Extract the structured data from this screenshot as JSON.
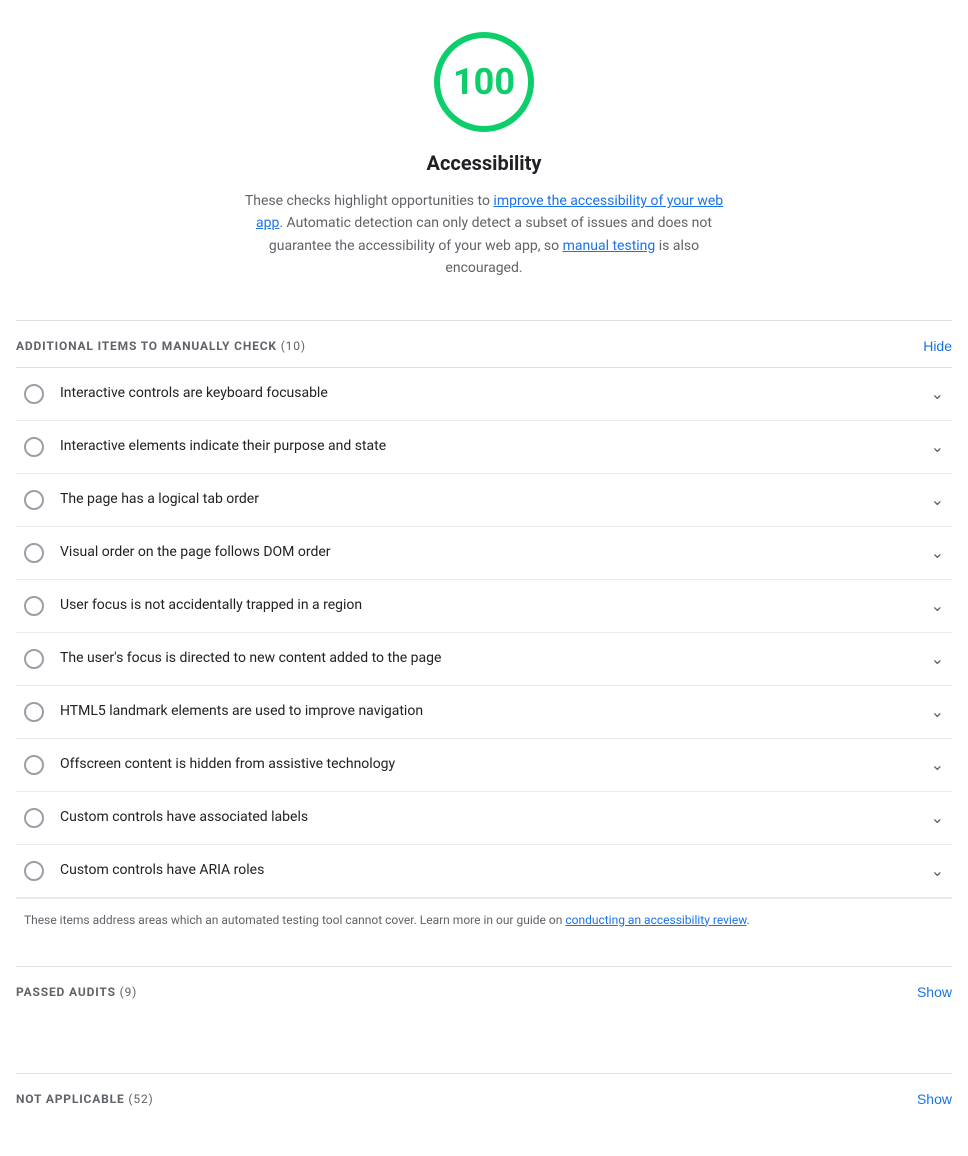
{
  "score": {
    "value": "100",
    "circle_color": "#0cce6b",
    "title": "Accessibility"
  },
  "description": {
    "before_link1": "These checks highlight opportunities to ",
    "link1_text": "improve the accessibility of your web app",
    "between_links": ". Automatic detection can only detect a subset of issues and does not guarantee the accessibility of your web app, so ",
    "link2_text": "manual testing",
    "after_link2": " is also encouraged."
  },
  "manual_check_section": {
    "label": "ADDITIONAL ITEMS TO MANUALLY CHECK",
    "count": "(10)",
    "hide_button": "Hide"
  },
  "audit_items": [
    {
      "id": "item-1",
      "label": "Interactive controls are keyboard focusable"
    },
    {
      "id": "item-2",
      "label": "Interactive elements indicate their purpose and state"
    },
    {
      "id": "item-3",
      "label": "The page has a logical tab order"
    },
    {
      "id": "item-4",
      "label": "Visual order on the page follows DOM order"
    },
    {
      "id": "item-5",
      "label": "User focus is not accidentally trapped in a region"
    },
    {
      "id": "item-6",
      "label": "The user's focus is directed to new content added to the page"
    },
    {
      "id": "item-7",
      "label": "HTML5 landmark elements are used to improve navigation"
    },
    {
      "id": "item-8",
      "label": "Offscreen content is hidden from assistive technology"
    },
    {
      "id": "item-9",
      "label": "Custom controls have associated labels"
    },
    {
      "id": "item-10",
      "label": "Custom controls have ARIA roles"
    }
  ],
  "footer_note": {
    "before_link": "These items address areas which an automated testing tool cannot cover. Learn more in our guide on ",
    "link_text": "conducting an accessibility review",
    "after_link": "."
  },
  "passed_section": {
    "label": "PASSED AUDITS",
    "count": "(9)",
    "show_button": "Show"
  },
  "not_applicable_section": {
    "label": "NOT APPLICABLE",
    "count": "(52)",
    "show_button": "Show"
  }
}
